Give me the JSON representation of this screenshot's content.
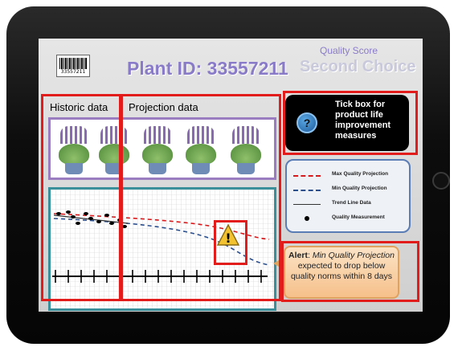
{
  "header": {
    "barcode_number": "33557211",
    "plant_id": "Plant ID: 33557211",
    "quality_score_label": "Quality Score",
    "quality_score_value": "Second Choice"
  },
  "sections": {
    "historic_title": "Historic data",
    "projection_title": "Projection data"
  },
  "info_button": {
    "icon": "question-icon",
    "glyph": "?",
    "label": "Tick box for product life improvement measures"
  },
  "legend": {
    "items": [
      {
        "label": "Max Quality Projection",
        "style": "dashed",
        "color": "#d7191c"
      },
      {
        "label": "Min Quality Projection",
        "style": "dashed",
        "color": "#2b4e8c"
      },
      {
        "label": "Trend Line Data",
        "style": "solid",
        "color": "#333333"
      },
      {
        "label": "Quality Measurement",
        "style": "dot",
        "color": "#000000"
      }
    ]
  },
  "alert": {
    "prefix": "Alert",
    "emphasis": "Min Quality Projection",
    "suffix": "expected to drop below quality norms within 8 days",
    "icon": "warning-icon",
    "glyph": "!"
  },
  "colors": {
    "accent": "#8a7bc8",
    "highlight": "#e21b1b",
    "plants_border": "#9a7dc0",
    "chart_border": "#3b8f9a"
  }
}
